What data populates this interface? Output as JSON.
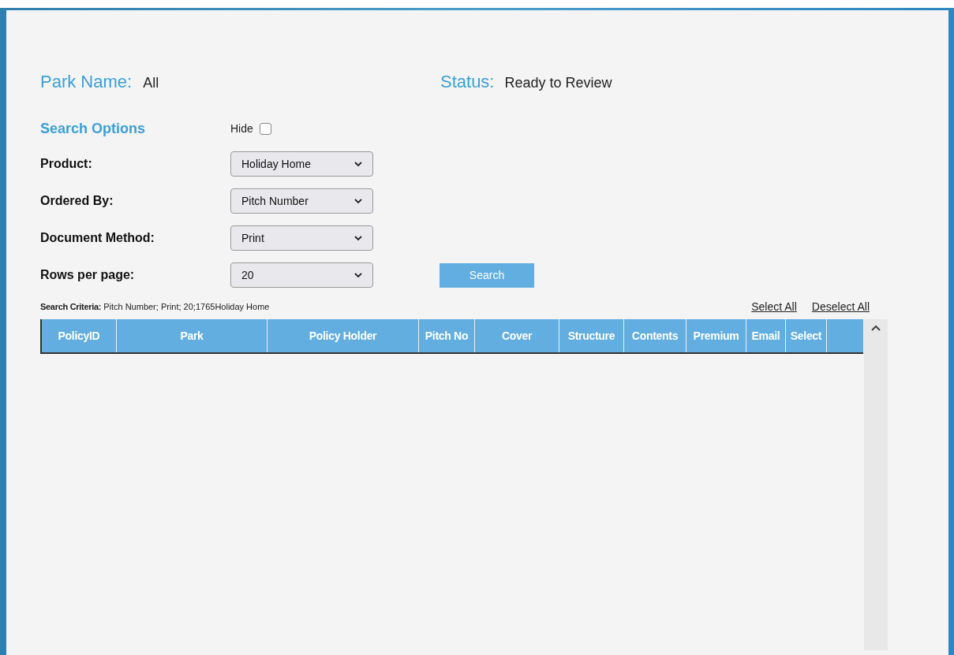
{
  "park_name": {
    "label": "Park Name:",
    "value": "All"
  },
  "status": {
    "label": "Status:",
    "value": "Ready to Review"
  },
  "search_options": {
    "title": "Search Options",
    "hide_label": "Hide",
    "hide_checked": false
  },
  "fields": [
    {
      "label": "Product:",
      "value": "Holiday Home"
    },
    {
      "label": "Ordered By:",
      "value": "Pitch Number"
    },
    {
      "label": "Document Method:",
      "value": "Print"
    },
    {
      "label": "Rows per page:",
      "value": "20"
    }
  ],
  "search_button": "Search",
  "search_criteria": {
    "label": "Search Criteria:",
    "value": "Pitch Number; Print; 20;1765Holiday Home"
  },
  "links": [
    "Select All",
    "Deselect All"
  ],
  "table": {
    "columns": [
      "PolicyID",
      "Park",
      "Policy Holder",
      "Pitch No",
      "Cover",
      "Structure",
      "Contents",
      "Premium",
      "Email",
      "Select"
    ]
  }
}
